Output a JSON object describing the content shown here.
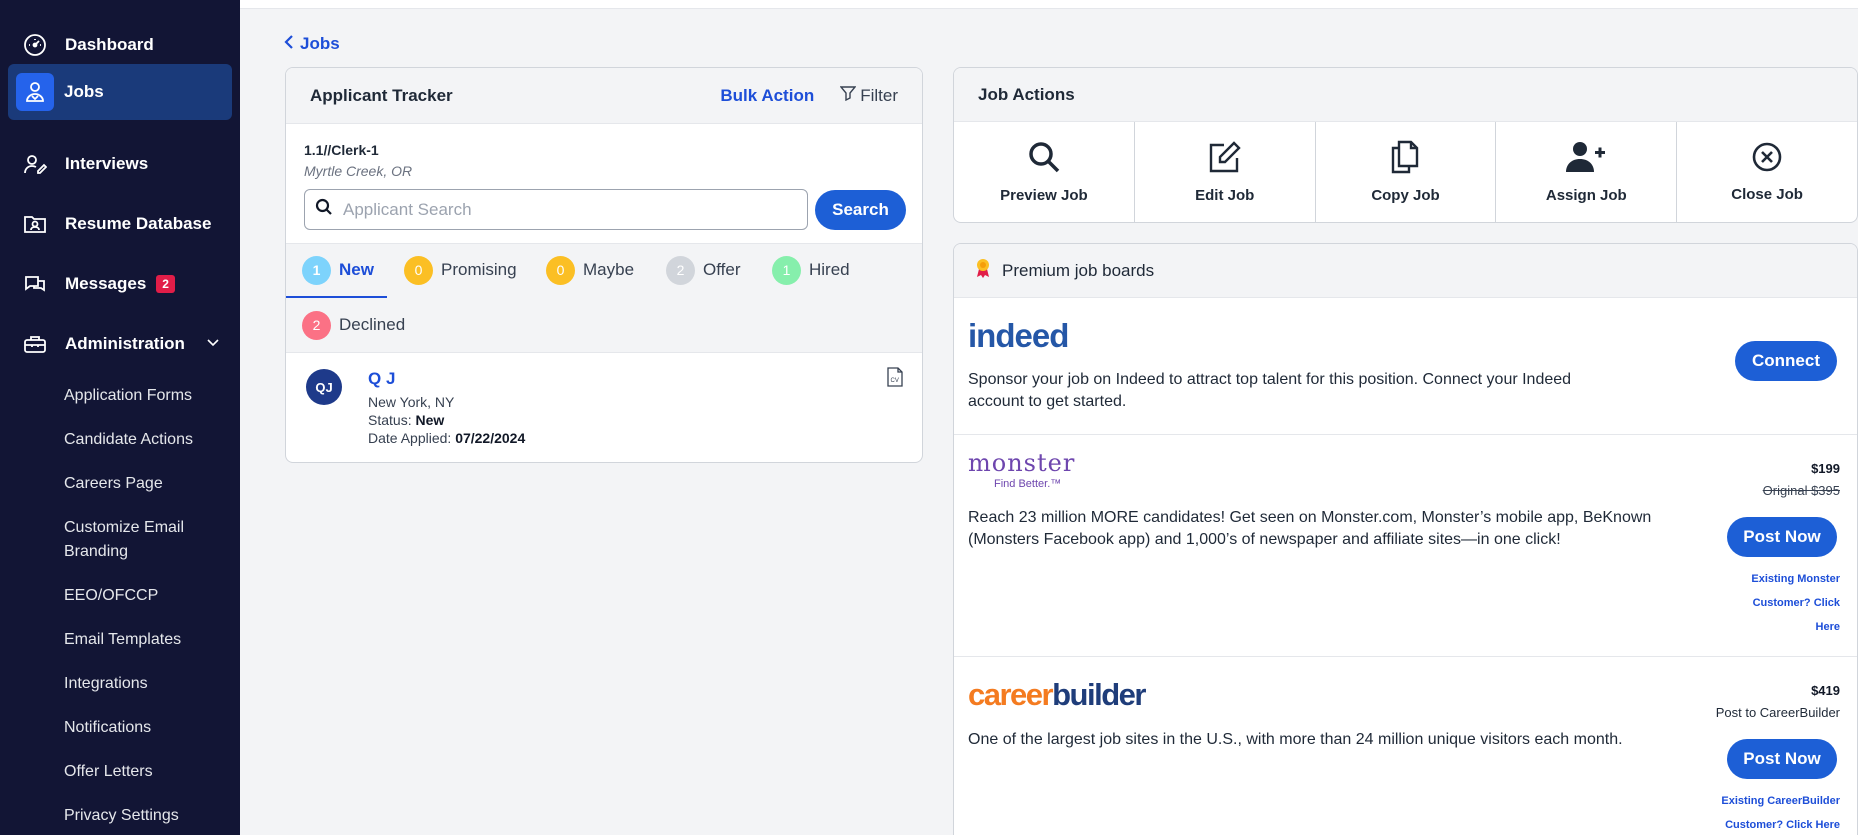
{
  "sidebar": {
    "items": [
      {
        "label": "Dashboard",
        "icon": "gauge-icon"
      },
      {
        "label": "Jobs",
        "icon": "jobs-person-icon"
      },
      {
        "label": "Interviews",
        "icon": "interview-icon"
      },
      {
        "label": "Resume Database",
        "icon": "folder-person-icon"
      },
      {
        "label": "Messages",
        "icon": "chat-icon",
        "badge": "2"
      },
      {
        "label": "Administration",
        "icon": "toolbox-icon"
      }
    ],
    "admin_items": [
      "Application Forms",
      "Candidate Actions",
      "Careers Page",
      "Customize Email Branding",
      "EEO/OFCCP",
      "Email Templates",
      "Integrations",
      "Notifications",
      "Offer Letters",
      "Privacy Settings"
    ]
  },
  "breadcrumb": {
    "back_label": "Jobs"
  },
  "tracker": {
    "title": "Applicant Tracker",
    "bulk_action": "Bulk Action",
    "filter": "Filter",
    "job_code": "1.1//Clerk-1",
    "job_location": "Myrtle Creek, OR",
    "search_placeholder": "Applicant Search",
    "search_button": "Search",
    "tabs": [
      {
        "label": "New",
        "count": "1",
        "color": "#7dd3fc"
      },
      {
        "label": "Promising",
        "count": "0",
        "color": "#fbbf24"
      },
      {
        "label": "Maybe",
        "count": "0",
        "color": "#fbbf24"
      },
      {
        "label": "Offer",
        "count": "2",
        "color": "#d1d5db"
      },
      {
        "label": "Hired",
        "count": "1",
        "color": "#86efac"
      },
      {
        "label": "Declined",
        "count": "2",
        "color": "#fb7185"
      }
    ],
    "applicant": {
      "initials": "QJ",
      "name": "Q J",
      "location": "New York, NY",
      "status_label": "Status:",
      "status": "New",
      "date_label": "Date Applied:",
      "date": "07/22/2024"
    }
  },
  "job_actions": {
    "title": "Job Actions",
    "actions": [
      {
        "label": "Preview Job",
        "icon": "search-icon"
      },
      {
        "label": "Edit Job",
        "icon": "edit-icon"
      },
      {
        "label": "Copy Job",
        "icon": "copy-icon"
      },
      {
        "label": "Assign Job",
        "icon": "user-plus-icon"
      },
      {
        "label": "Close Job",
        "icon": "close-circle-icon"
      }
    ]
  },
  "boards": {
    "title": "Premium job boards",
    "indeed": {
      "logo": "indeed",
      "desc": "Sponsor your job on Indeed to attract top talent for this position. Connect your Indeed account to get started.",
      "button": "Connect"
    },
    "monster": {
      "logo": "monster",
      "tagline": "Find Better.™",
      "price": "$199",
      "original": "Original $395",
      "desc": "Reach 23 million MORE candidates! Get seen on Monster.com, Monster’s mobile app, BeKnown (Monsters Facebook app) and 1,000’s of newspaper and affiliate sites—in one click!",
      "button": "Post Now",
      "link_lines": [
        "Existing Monster",
        "Customer? Click",
        "Here"
      ]
    },
    "careerbuilder": {
      "logo_a": "career",
      "logo_b": "builder",
      "price": "$419",
      "note": "Post to CareerBuilder",
      "desc": "One of the largest job sites in the U.S., with more than 24 million unique visitors each month.",
      "button": "Post Now",
      "link_lines": [
        "Existing CareerBuilder",
        "Customer? Click Here"
      ]
    }
  }
}
